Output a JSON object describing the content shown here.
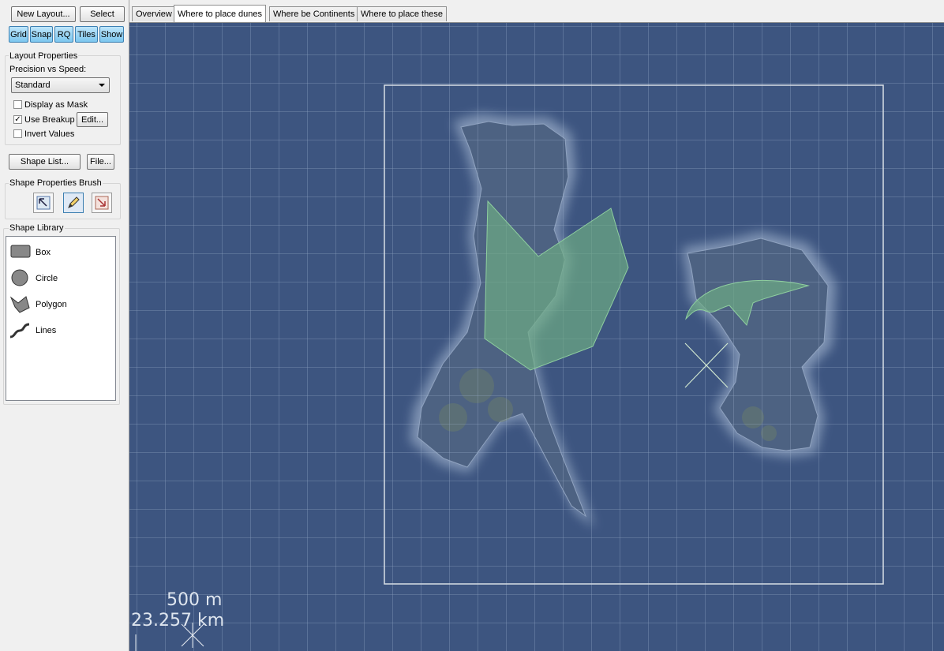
{
  "toolbar": {
    "new_layout": "New Layout...",
    "select": "Select",
    "toggles": [
      "Grid",
      "Snap",
      "RQ",
      "Tiles",
      "Show"
    ]
  },
  "layout_properties": {
    "title": "Layout Properties",
    "precision_label": "Precision vs Speed:",
    "precision_value": "Standard",
    "display_as_mask": {
      "label": "Display as Mask",
      "checked": false
    },
    "use_breakup": {
      "label": "Use Breakup",
      "checked": true
    },
    "edit_button": "Edit...",
    "invert_values": {
      "label": "Invert Values",
      "checked": false
    }
  },
  "shape_buttons": {
    "shape_list": "Shape List...",
    "file": "File..."
  },
  "shape_properties_brush": {
    "title": "Shape Properties Brush",
    "tools": [
      "select-arrow-icon",
      "pencil-icon",
      "stamp-arrow-icon"
    ]
  },
  "shape_library": {
    "title": "Shape Library",
    "items": [
      {
        "label": "Box",
        "icon": "box-shape-icon"
      },
      {
        "label": "Circle",
        "icon": "circle-shape-icon"
      },
      {
        "label": "Polygon",
        "icon": "polygon-shape-icon"
      },
      {
        "label": "Lines",
        "icon": "lines-shape-icon"
      }
    ]
  },
  "tabs": [
    {
      "label": "Overview",
      "active": false
    },
    {
      "label": "Where to place dunes",
      "active": true
    },
    {
      "label": "Where be Continents",
      "active": false
    },
    {
      "label": "Where to place these",
      "active": false
    }
  ],
  "map": {
    "scale_grid": "500 m",
    "scale_extent": "23.257 km",
    "colors": {
      "ocean": "#3d5580",
      "land": "#4d6282",
      "shape_fill": "#6fae83",
      "grid": "#9fb3cf",
      "boundary": "#d8dee6"
    }
  }
}
